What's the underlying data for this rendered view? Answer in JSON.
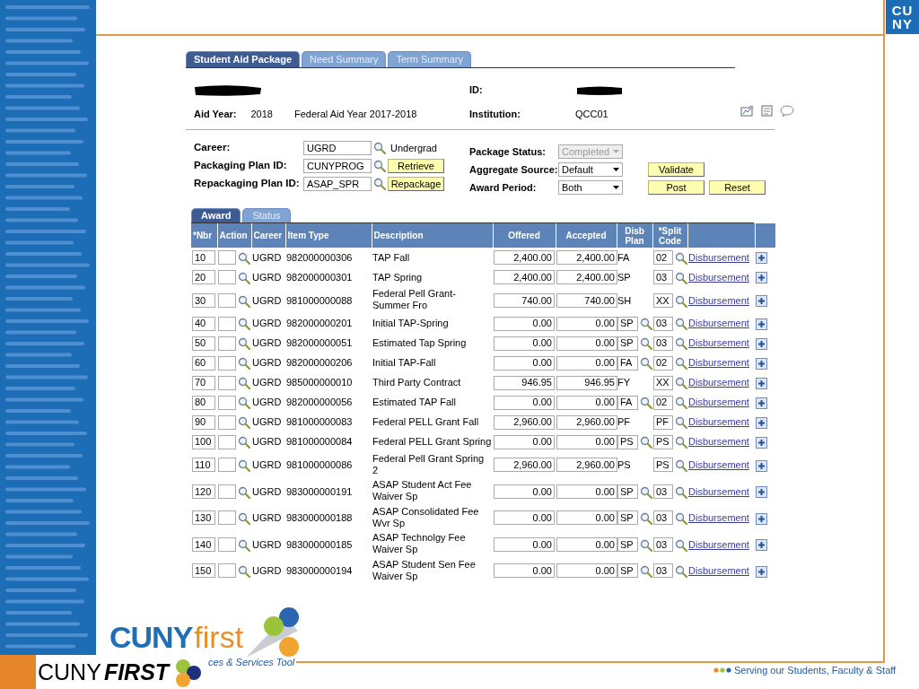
{
  "tabs": [
    {
      "label": "Student Aid Package",
      "selected": true
    },
    {
      "label": "Need Summary",
      "selected": false
    },
    {
      "label": "Term Summary",
      "selected": false
    }
  ],
  "header": {
    "aid_year_label": "Aid Year:",
    "aid_year": "2018",
    "aid_year_desc": "Federal Aid Year 2017-2018",
    "id_label": "ID:",
    "institution_label": "Institution:",
    "institution": "QCC01"
  },
  "form_left": [
    {
      "label": "Career:",
      "value": "UGRD",
      "extra": {
        "kind": "text",
        "text": "Undergrad"
      }
    },
    {
      "label": "Packaging Plan ID:",
      "value": "CUNYPROG",
      "extra": {
        "kind": "button",
        "text": "Retrieve"
      }
    },
    {
      "label": "Repackaging Plan ID:",
      "value": "ASAP_SPR",
      "extra": {
        "kind": "button",
        "text": "Repackage"
      }
    }
  ],
  "form_right": [
    {
      "label": "Package Status:",
      "value": "Completed",
      "disabled": true
    },
    {
      "label": "Aggregate Source:",
      "value": "Default",
      "disabled": false,
      "buttons": [
        "Validate"
      ]
    },
    {
      "label": "Award Period:",
      "value": "Both",
      "disabled": false,
      "buttons": [
        "Post",
        "Reset"
      ]
    }
  ],
  "subtabs": [
    {
      "label": "Award",
      "selected": true
    },
    {
      "label": "Status",
      "selected": false
    }
  ],
  "columns": [
    "*Nbr",
    "Action",
    "Career",
    "Item Type",
    "Description",
    "Offered",
    "Accepted",
    "Disb Plan",
    "*Split Code"
  ],
  "rows": [
    {
      "nbr": "10",
      "career": "UGRD",
      "item_type": "982000000306",
      "description": "TAP Fall",
      "offered": "2,400.00",
      "accepted": "2,400.00",
      "disb_plan": "FA",
      "disb_editable": false,
      "split_code": "02",
      "link": "Disbursement"
    },
    {
      "nbr": "20",
      "career": "UGRD",
      "item_type": "982000000301",
      "description": "TAP Spring",
      "offered": "2,400.00",
      "accepted": "2,400.00",
      "disb_plan": "SP",
      "disb_editable": false,
      "split_code": "03",
      "link": "Disbursement"
    },
    {
      "nbr": "30",
      "career": "UGRD",
      "item_type": "981000000088",
      "description": "Federal Pell Grant-Summer Fro",
      "offered": "740.00",
      "accepted": "740.00",
      "disb_plan": "SH",
      "disb_editable": false,
      "split_code": "XX",
      "link": "Disbursement"
    },
    {
      "nbr": "40",
      "career": "UGRD",
      "item_type": "982000000201",
      "description": "Initial TAP-Spring",
      "offered": "0.00",
      "accepted": "0.00",
      "disb_plan": "SP",
      "disb_editable": true,
      "split_code": "03",
      "link": "Disbursement"
    },
    {
      "nbr": "50",
      "career": "UGRD",
      "item_type": "982000000051",
      "description": "Estimated Tap Spring",
      "offered": "0.00",
      "accepted": "0.00",
      "disb_plan": "SP",
      "disb_editable": true,
      "split_code": "03",
      "link": "Disbursement"
    },
    {
      "nbr": "60",
      "career": "UGRD",
      "item_type": "982000000206",
      "description": "Initial TAP-Fall",
      "offered": "0.00",
      "accepted": "0.00",
      "disb_plan": "FA",
      "disb_editable": true,
      "split_code": "02",
      "link": "Disbursement"
    },
    {
      "nbr": "70",
      "career": "UGRD",
      "item_type": "985000000010",
      "description": "Third Party Contract",
      "offered": "946.95",
      "accepted": "946.95",
      "disb_plan": "FY",
      "disb_editable": false,
      "split_code": "XX",
      "link": "Disbursement"
    },
    {
      "nbr": "80",
      "career": "UGRD",
      "item_type": "982000000056",
      "description": "Estimated TAP Fall",
      "offered": "0.00",
      "accepted": "0.00",
      "disb_plan": "FA",
      "disb_editable": true,
      "split_code": "02",
      "link": "Disbursement"
    },
    {
      "nbr": "90",
      "career": "UGRD",
      "item_type": "981000000083",
      "description": "Federal PELL Grant Fall",
      "offered": "2,960.00",
      "accepted": "2,960.00",
      "disb_plan": "PF",
      "disb_editable": false,
      "split_code": "PF",
      "link": "Disbursement"
    },
    {
      "nbr": "100",
      "career": "UGRD",
      "item_type": "981000000084",
      "description": "Federal PELL Grant Spring",
      "offered": "0.00",
      "accepted": "0.00",
      "disb_plan": "PS",
      "disb_editable": true,
      "split_code": "PS",
      "link": "Disbursement"
    },
    {
      "nbr": "110",
      "career": "UGRD",
      "item_type": "981000000086",
      "description": "Federal Pell Grant Spring 2",
      "offered": "2,960.00",
      "accepted": "2,960.00",
      "disb_plan": "PS",
      "disb_editable": false,
      "split_code": "PS",
      "link": "Disbursement"
    },
    {
      "nbr": "120",
      "career": "UGRD",
      "item_type": "983000000191",
      "description": "ASAP Student Act Fee Waiver Sp",
      "offered": "0.00",
      "accepted": "0.00",
      "disb_plan": "SP",
      "disb_editable": true,
      "split_code": "03",
      "link": "Disbursement"
    },
    {
      "nbr": "130",
      "career": "UGRD",
      "item_type": "983000000188",
      "description": "ASAP Consolidated Fee Wvr Sp",
      "offered": "0.00",
      "accepted": "0.00",
      "disb_plan": "SP",
      "disb_editable": true,
      "split_code": "03",
      "link": "Disbursement"
    },
    {
      "nbr": "140",
      "career": "UGRD",
      "item_type": "983000000185",
      "description": "ASAP Technolgy Fee Waiver Sp",
      "offered": "0.00",
      "accepted": "0.00",
      "disb_plan": "SP",
      "disb_editable": true,
      "split_code": "03",
      "link": "Disbursement"
    },
    {
      "nbr": "150",
      "career": "UGRD",
      "item_type": "983000000194",
      "description": "ASAP Student Sen Fee Waiver Sp",
      "offered": "0.00",
      "accepted": "0.00",
      "disb_plan": "SP",
      "disb_editable": true,
      "split_code": "03",
      "link": "Disbursement"
    }
  ],
  "slide": {
    "corner_logo": [
      "CU",
      "NY"
    ],
    "logo_main": "CUNY",
    "logo_accent": "first",
    "logo_tagline": "ces & Services Tool",
    "footer_brand": "CUNY",
    "footer_brand_bold": "FIRST",
    "footer_slogan": "Serving our Students, Faculty & Staff"
  }
}
